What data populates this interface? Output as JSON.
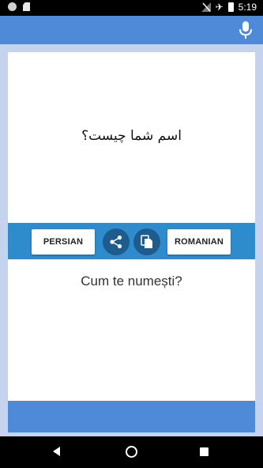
{
  "status_bar": {
    "time": "5:19",
    "battery_level": "",
    "icons": [
      "notification-dot-icon",
      "sd-card-icon",
      "no-signal-icon",
      "airplane-mode-icon",
      "battery-icon"
    ]
  },
  "toolbar": {
    "mic_icon": "microphone-icon"
  },
  "input": {
    "text": "اسم شما چیست؟"
  },
  "language_bar": {
    "source_language": "PERSIAN",
    "target_language": "ROMANIAN",
    "share_icon": "share-icon",
    "copy_icon": "copy-icon"
  },
  "output": {
    "text": "Cum te numești?"
  },
  "colors": {
    "toolbar": "#4f8ad8",
    "language_bar": "#2f8ccc",
    "round_button": "#1d5c8c",
    "background": "#c5d3ee"
  },
  "nav_bar": {
    "icons": [
      "back-icon",
      "home-icon",
      "recents-icon"
    ]
  }
}
